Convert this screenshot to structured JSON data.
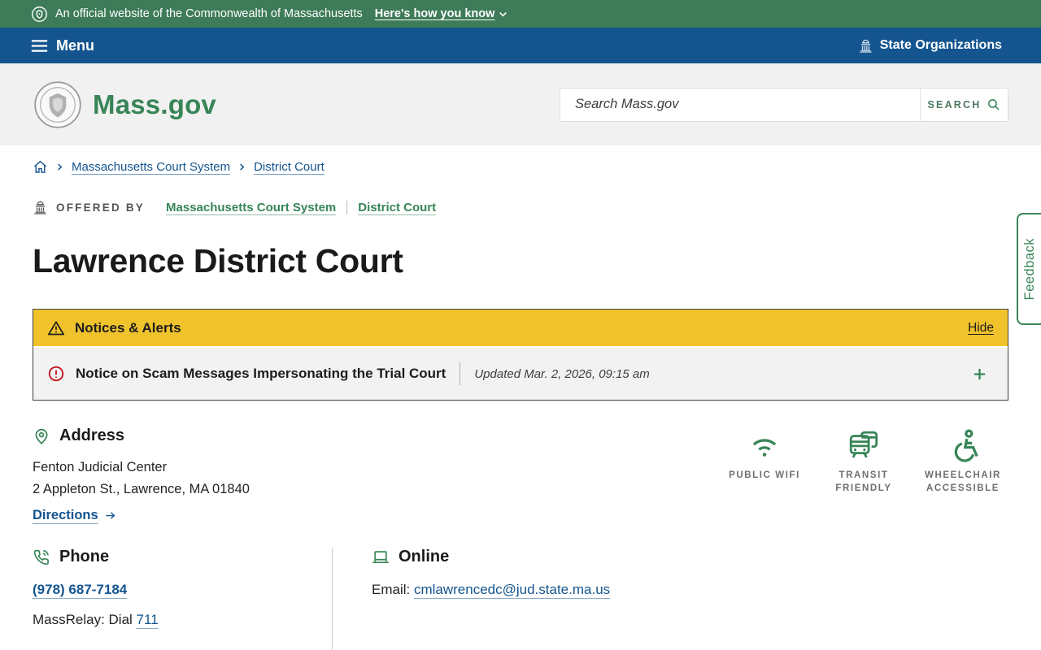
{
  "banner": {
    "official_text": "An official website of the Commonwealth of Massachusetts",
    "how_know_label": "Here's how you know"
  },
  "navbar": {
    "menu_label": "Menu",
    "state_orgs_label": "State Organizations"
  },
  "header": {
    "logo_text": "Mass.gov",
    "search_placeholder": "Search Mass.gov",
    "search_label": "SEARCH"
  },
  "breadcrumb": {
    "items": [
      {
        "label": "Massachusetts Court System"
      },
      {
        "label": "District Court"
      }
    ]
  },
  "offered_by": {
    "label": "OFFERED BY",
    "orgs": [
      {
        "label": "Massachusetts Court System"
      },
      {
        "label": "District Court"
      }
    ]
  },
  "page": {
    "title": "Lawrence District Court"
  },
  "alerts": {
    "header_label": "Notices & Alerts",
    "hide_label": "Hide",
    "notice": {
      "title": "Notice on Scam Messages Impersonating the Trial Court",
      "updated": "Updated Mar. 2, 2026, 09:15 am"
    }
  },
  "address": {
    "heading": "Address",
    "line1": "Fenton Judicial Center",
    "line2": "2 Appleton St., Lawrence, MA 01840",
    "directions_label": "Directions",
    "amenities": [
      {
        "label": "PUBLIC WIFI"
      },
      {
        "label": "TRANSIT FRIENDLY"
      },
      {
        "label": "WHEELCHAIR ACCESSIBLE"
      }
    ]
  },
  "phone": {
    "heading": "Phone",
    "number": "(978) 687-7184",
    "massrelay_prefix": "MassRelay: Dial ",
    "massrelay_number": "711"
  },
  "online": {
    "heading": "Online",
    "email_label": "Email: ",
    "email": "cmlawrencedc@jud.state.ma.us"
  },
  "feedback": {
    "label": "Feedback"
  },
  "colors": {
    "banner_green": "#3e7b59",
    "accent_green": "#388557",
    "primary_blue": "#14558f",
    "alert_yellow": "#f0c22c",
    "alert_red": "#c1121c",
    "header_gray": "#f1f1f1"
  }
}
